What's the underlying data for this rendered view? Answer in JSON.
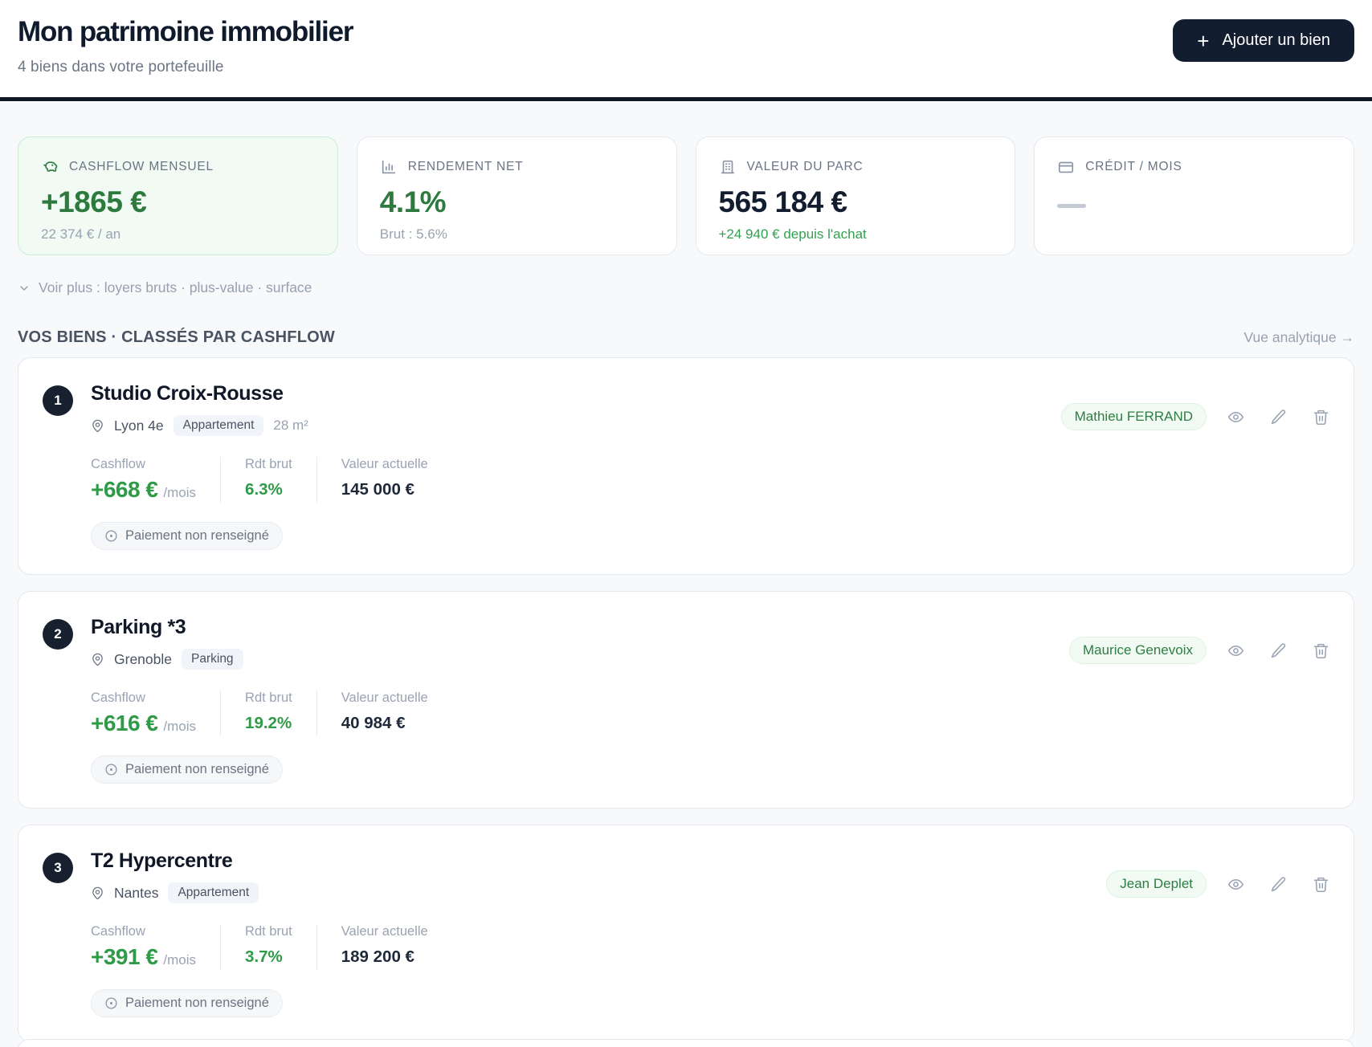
{
  "header": {
    "title": "Mon patrimoine immobilier",
    "subtitle": "4 biens dans votre portefeuille",
    "add_button": {
      "plus": "+",
      "label": "Ajouter un bien"
    }
  },
  "stats": {
    "cashflow": {
      "icon": "piggy-bank-icon",
      "label": "CASHFLOW MENSUEL",
      "value": "+1865 €",
      "sub": "22 374 € / an"
    },
    "rendement": {
      "icon": "bar-chart-icon",
      "label": "RENDEMENT NET",
      "value": "4.1%",
      "sub": "Brut : 5.6%"
    },
    "valeur": {
      "icon": "building-icon",
      "label": "VALEUR DU PARC",
      "value": "565 184 €",
      "sub": "+24 940 € depuis l'achat"
    },
    "credit": {
      "icon": "credit-card-icon",
      "label": "CRÉDIT / MOIS",
      "value": "",
      "sub": ""
    }
  },
  "voir_plus": "Voir plus : loyers bruts · plus-value · surface",
  "section": {
    "title": "VOS BIENS · CLASSÉS PAR CASHFLOW",
    "link": "Vue analytique →"
  },
  "labels": {
    "cashflow": "Cashflow",
    "per_month": "/mois",
    "rdt": "Rdt brut",
    "value": "Valeur actuelle",
    "status": "Paiement non renseigné"
  },
  "properties": [
    {
      "rank": "1",
      "name": "Studio Croix-Rousse",
      "city": "Lyon 4e",
      "type": "Appartement",
      "surface": "28 m²",
      "cashflow": "+668 €",
      "rdt": "6.3%",
      "value": "145 000 €",
      "owner": "Mathieu FERRAND"
    },
    {
      "rank": "2",
      "name": "Parking *3",
      "city": "Grenoble",
      "type": "Parking",
      "surface": "",
      "cashflow": "+616 €",
      "rdt": "19.2%",
      "value": "40 984 €",
      "owner": "Maurice Genevoix"
    },
    {
      "rank": "3",
      "name": "T2 Hypercentre",
      "city": "Nantes",
      "type": "Appartement",
      "surface": "",
      "cashflow": "+391 €",
      "rdt": "3.7%",
      "value": "189 200 €",
      "owner": "Jean Deplet"
    }
  ],
  "colors": {
    "accent_dark": "#131d30",
    "green_dark": "#2d7a3f",
    "green_bright": "#2f9a47",
    "highlight_card_bg": "#f1fbf3",
    "page_bg": "#f7f9fb"
  }
}
